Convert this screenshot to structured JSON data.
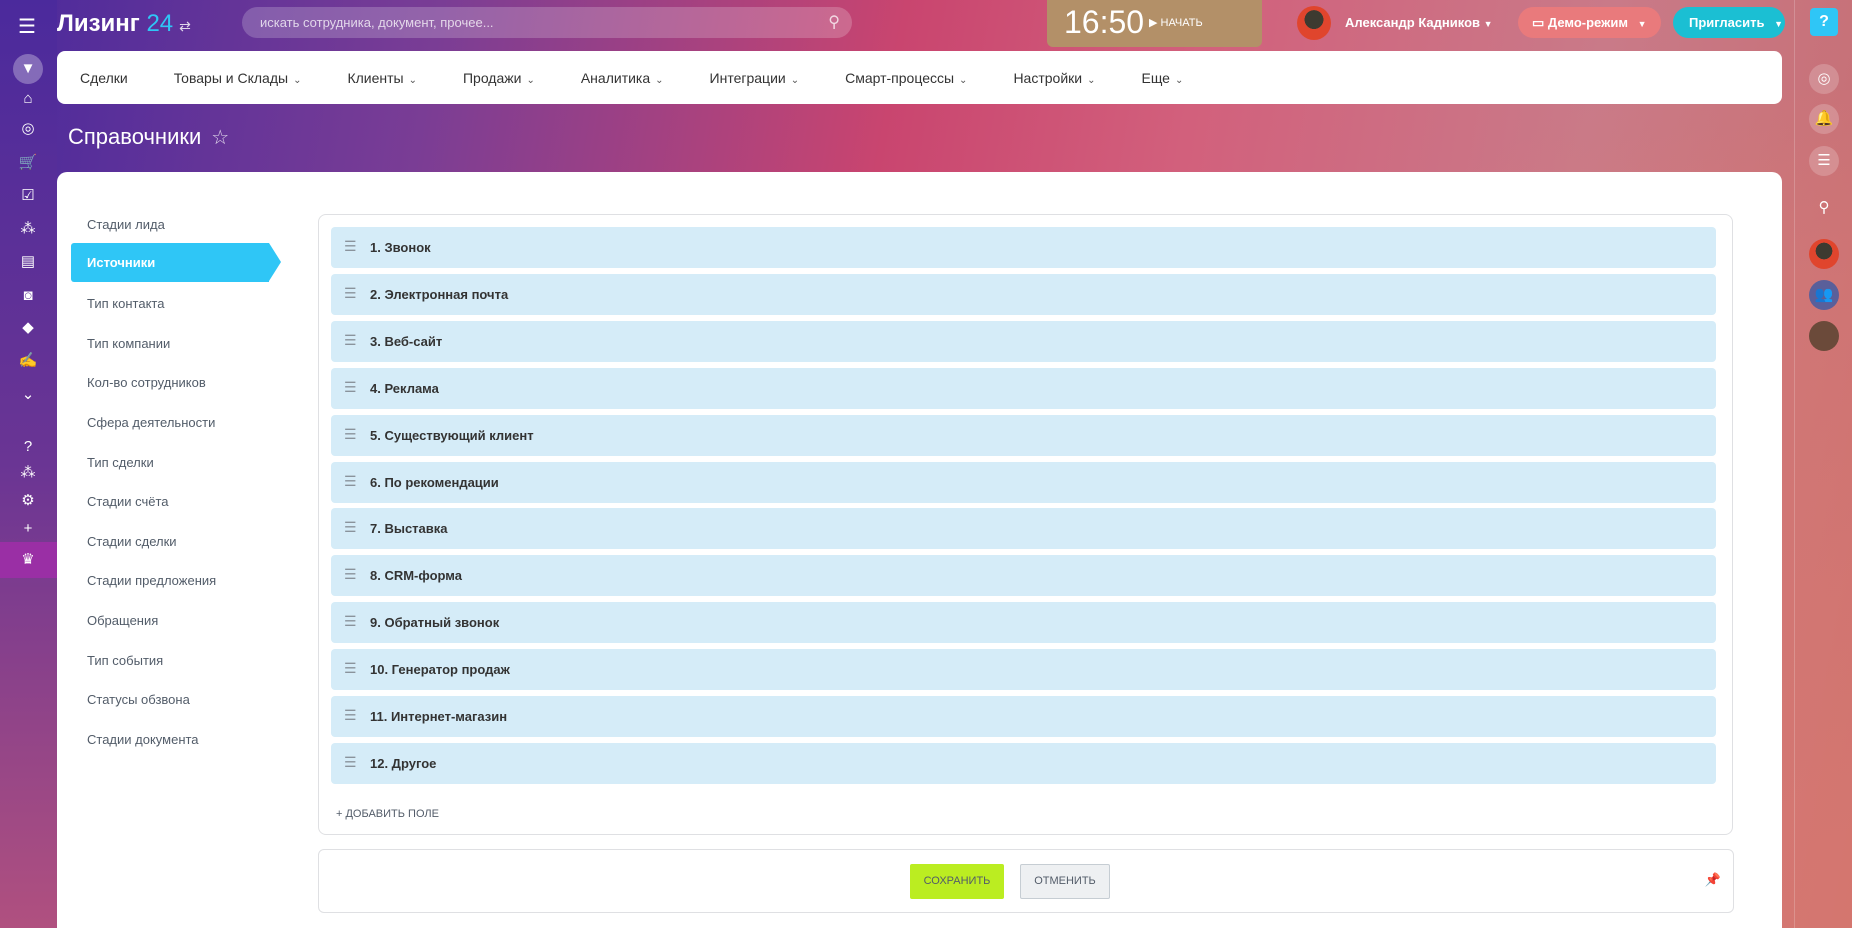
{
  "header": {
    "logo_text": "Лизинг",
    "logo_num": "24",
    "search_placeholder": "искать сотрудника, документ, прочее...",
    "time": "16:50",
    "start_label": "НАЧАТЬ",
    "user_name": "Александр Кадников",
    "demo_label": "Демо-режим",
    "invite_label": "Пригласить",
    "help": "?"
  },
  "nav": {
    "items": [
      {
        "label": "Сделки",
        "dd": false
      },
      {
        "label": "Товары и Склады",
        "dd": true
      },
      {
        "label": "Клиенты",
        "dd": true
      },
      {
        "label": "Продажи",
        "dd": true
      },
      {
        "label": "Аналитика",
        "dd": true
      },
      {
        "label": "Интеграции",
        "dd": true
      },
      {
        "label": "Смарт-процессы",
        "dd": true
      },
      {
        "label": "Настройки",
        "dd": true
      },
      {
        "label": "Еще",
        "dd": true
      }
    ]
  },
  "page": {
    "title": "Справочники"
  },
  "menu": {
    "active": "Источники",
    "items": [
      "Стадии лида",
      "Источники",
      "Тип контакта",
      "Тип компании",
      "Кол-во сотрудников",
      "Сфера деятельности",
      "Тип сделки",
      "Стадии счёта",
      "Стадии сделки",
      "Стадии предложения",
      "Обращения",
      "Тип события",
      "Статусы обзвона",
      "Стадии документа"
    ]
  },
  "list": {
    "items": [
      "1. Звонок",
      "2. Электронная почта",
      "3. Веб-сайт",
      "4. Реклама",
      "5. Существующий клиент",
      "6. По рекомендации",
      "7. Выставка",
      "8. CRM-форма",
      "9. Обратный звонок",
      "10. Генератор продаж",
      "11. Интернет-магазин",
      "12. Другое"
    ],
    "add_label": "+ ДОБАВИТЬ ПОЛЕ"
  },
  "footer": {
    "save_label": "СОХРАНИТЬ",
    "cancel_label": "ОТМЕНИТЬ"
  },
  "colors": {
    "accent": "#2fc6f6",
    "save": "#bbed21",
    "row": "#d5ecf8"
  }
}
